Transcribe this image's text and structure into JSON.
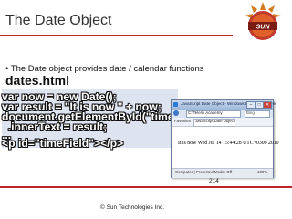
{
  "slide": {
    "title": "The Date Object",
    "bullet": "• The Date object provides date / calendar functions",
    "filename": "dates.html",
    "code_lines": [
      "var now = new Date();",
      "var result = \"It is now \" + now;",
      "document.getElementById(\"timeField\")",
      "  .innerText = result;",
      "...",
      "<p id=\"timeField\"></p>"
    ],
    "page_number": "214",
    "footer": "© Sun Technologies Inc.",
    "accent_color": "#b9252a"
  },
  "browser": {
    "window_title": "JavaScript Date Object - Windows Internet Explorer",
    "address": "C:\\Telerik Academy",
    "search_placeholder": "Bing",
    "favorites": "Favorites",
    "tab_title": "JavaScript Date Object",
    "page_text": "It is now Wed Jul 14 15:44:28 UTC+0300 2010",
    "status": "Computer | Protected Mode: Off",
    "zoom": "100%",
    "controls": {
      "minimize": "–",
      "maximize": "□",
      "close": "✕"
    }
  }
}
